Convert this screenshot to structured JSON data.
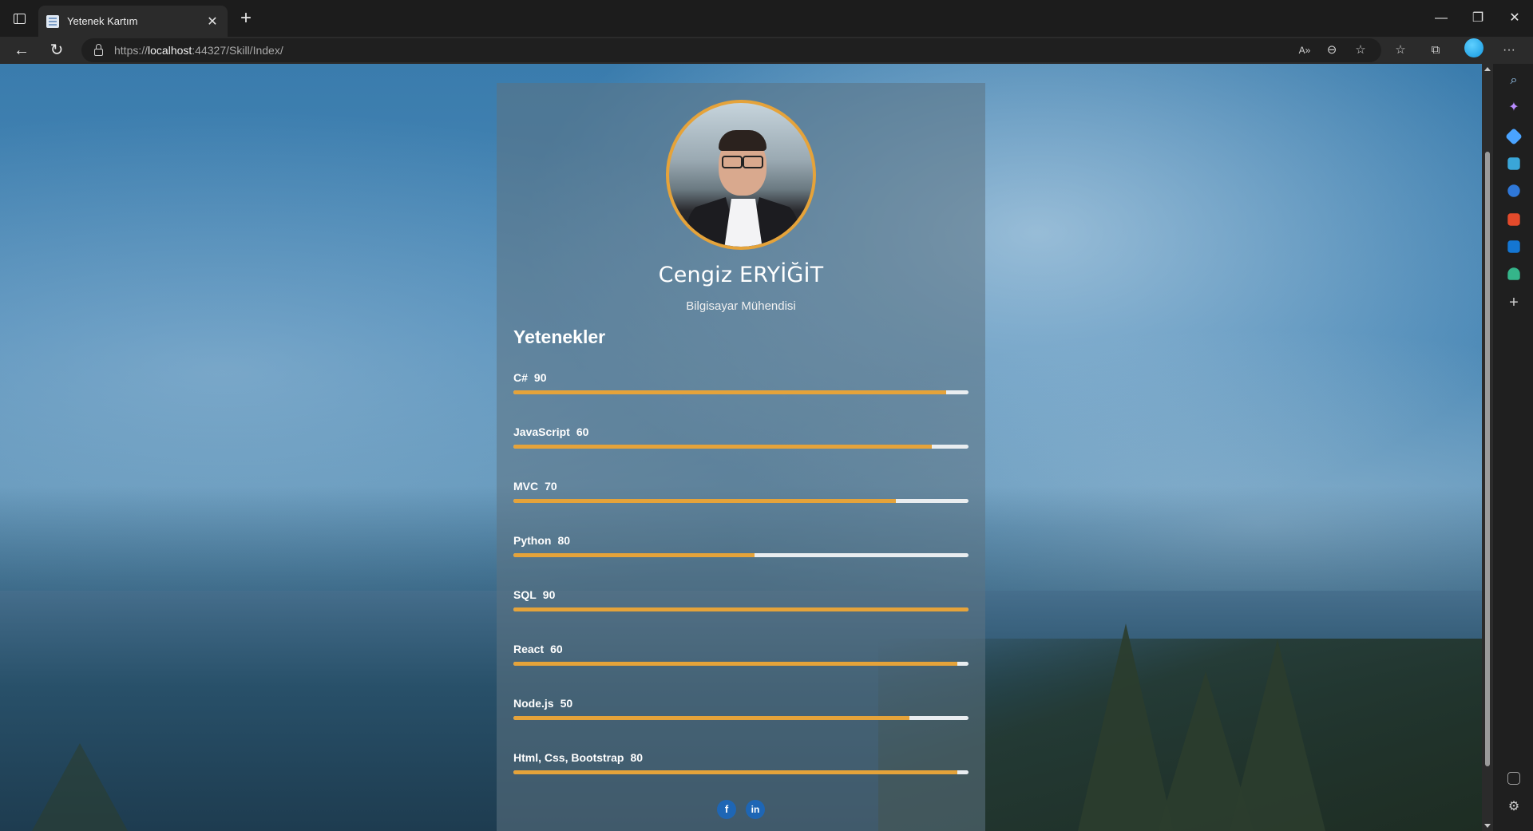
{
  "browser": {
    "tab_title": "Yetenek Kartım",
    "tab_close": "✕",
    "new_tab": "+",
    "url_prefix": "https://",
    "url_host": "localhost",
    "url_rest": ":44327/Skill/Index/",
    "window_controls": {
      "minimize": "—",
      "restore": "❐",
      "close": "✕"
    },
    "nav": {
      "back": "←",
      "refresh": "↻"
    },
    "toolbar_icons": [
      "read-aloud-icon",
      "zoom-icon",
      "add-favorite-icon",
      "favorites-icon",
      "collections-icon",
      "profile-icon",
      "more-icon"
    ],
    "more": "···"
  },
  "profile": {
    "name": "Cengiz ERYİĞİT",
    "title": "Bilgisayar Mühendisi"
  },
  "skills_heading": "Yetenekler",
  "skills": [
    {
      "name": "C#",
      "value": "90",
      "bar_fraction": 0.95
    },
    {
      "name": "JavaScript",
      "value": "60",
      "bar_fraction": 0.92
    },
    {
      "name": "MVC",
      "value": "70",
      "bar_fraction": 0.84
    },
    {
      "name": "Python",
      "value": "80",
      "bar_fraction": 0.53
    },
    {
      "name": "SQL",
      "value": "90",
      "bar_fraction": 1.0
    },
    {
      "name": "React",
      "value": "60",
      "bar_fraction": 0.975
    },
    {
      "name": "Node.js",
      "value": "50",
      "bar_fraction": 0.87
    },
    {
      "name": "Html, Css, Bootstrap",
      "value": "80",
      "bar_fraction": 0.975
    }
  ],
  "social": {
    "facebook": "f",
    "linkedin": "in"
  },
  "colors": {
    "accent": "#e5a33a",
    "track": "#e9edf0",
    "social": "#1e66b5"
  }
}
